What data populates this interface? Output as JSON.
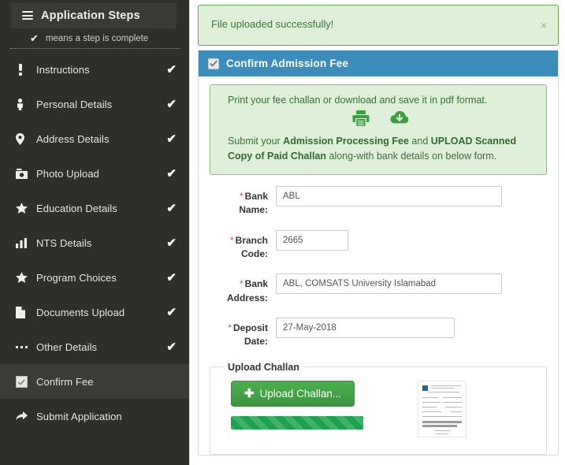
{
  "sidebar": {
    "menu_icon": "hamburger-icon",
    "title": "Application Steps",
    "legend_check": "✔",
    "legend_text": "means a step is complete",
    "check_mark": "✔",
    "items": [
      {
        "label": "Instructions",
        "icon": "exclamation-icon",
        "complete": true,
        "active": false
      },
      {
        "label": "Personal Details",
        "icon": "user-icon",
        "complete": true,
        "active": false
      },
      {
        "label": "Address Details",
        "icon": "map-marker-icon",
        "complete": true,
        "active": false
      },
      {
        "label": "Photo Upload",
        "icon": "camera-icon",
        "complete": true,
        "active": false
      },
      {
        "label": "Education Details",
        "icon": "star-icon",
        "complete": true,
        "active": false
      },
      {
        "label": "NTS Details",
        "icon": "bar-chart-icon",
        "complete": true,
        "active": false
      },
      {
        "label": "Program Choices",
        "icon": "star-icon",
        "complete": true,
        "active": false
      },
      {
        "label": "Documents Upload",
        "icon": "file-icon",
        "complete": true,
        "active": false
      },
      {
        "label": "Other Details",
        "icon": "ellipsis-icon",
        "complete": true,
        "active": false
      },
      {
        "label": "Confirm Fee",
        "icon": "checkbox-icon",
        "complete": false,
        "active": true
      },
      {
        "label": "Submit Application",
        "icon": "share-arrow-icon",
        "complete": false,
        "active": false
      }
    ]
  },
  "alert": {
    "message": "File uploaded successfully!",
    "close_label": "×"
  },
  "panel": {
    "title": "Confirm Admission Fee",
    "title_icon": "checkbox-checked-icon",
    "notice": {
      "line1": "Print your fee challan or download and save it in pdf format.",
      "print_icon": "printer-icon",
      "download_icon": "cloud-download-icon",
      "line2_a": "Submit your ",
      "line2_b1": "Admission Processing Fee",
      "line2_c": " and ",
      "line2_b2": "UPLOAD Scanned Copy of Paid Challan",
      "line2_d": " along-with bank details on below form."
    },
    "form": {
      "required_marker": "*",
      "fields": [
        {
          "label": "Bank Name:",
          "value": "ABL",
          "placeholder": "Bank Name",
          "name": "bank-name"
        },
        {
          "label": "Branch Code:",
          "value": "2665",
          "placeholder": "Branch Code",
          "name": "branch-code"
        },
        {
          "label": "Bank Address:",
          "value": "ABL, COMSATS University Islamabad",
          "placeholder": "Bank Address",
          "name": "bank-address"
        },
        {
          "label": "Deposit Date:",
          "value": "27-May-2018",
          "placeholder": "Deposit Date",
          "name": "deposit-date"
        }
      ]
    },
    "upload": {
      "legend": "Upload Challan",
      "button_label": "Upload Challan...",
      "button_plus": "✚",
      "progress_percent": 100,
      "thumbnail_name": "uploaded-challan-thumbnail"
    }
  },
  "colors": {
    "sidebar_bg": "#2e2e2b",
    "sidebar_active": "#3b3b37",
    "panel_header_blue": "#3c8dbc",
    "alert_green_bg": "#dff0d8",
    "alert_green_text": "#3c763d",
    "button_green": "#43a047",
    "progress_green": "#1aa34a",
    "required_red": "#d9534f"
  }
}
